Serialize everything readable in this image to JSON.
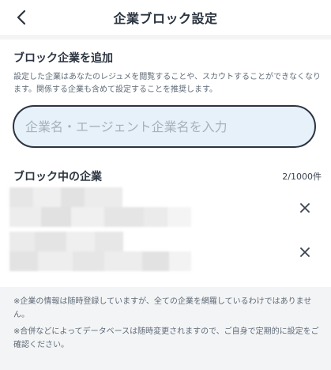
{
  "header": {
    "title": "企業ブロック設定",
    "back_icon": "chevron-left-icon"
  },
  "add_section": {
    "title": "ブロック企業を追加",
    "description": "設定した企業はあなたのレジュメを閲覧することや、スカウトすることができなくなります。関係する企業も含めて設定することを推奨します。",
    "search": {
      "placeholder": "企業名・エージェント企業名を入力",
      "value": ""
    }
  },
  "blocked_section": {
    "title": "ブロック中の企業",
    "count": "2/1000件",
    "remove_icon": "close-icon"
  },
  "notes": [
    "※企業の情報は随時登録していますが、全ての企業を網羅しているわけではありません。",
    "※合併などによってデータベースは随時変更されますので、ご自身で定期的に設定をご確認ください。"
  ],
  "colors": {
    "text": "#2b3440",
    "subtext": "#606b78",
    "search_bg": "#e6f1f9",
    "placeholder": "#a7b1bc",
    "gray_bg": "#f3f4f5"
  }
}
